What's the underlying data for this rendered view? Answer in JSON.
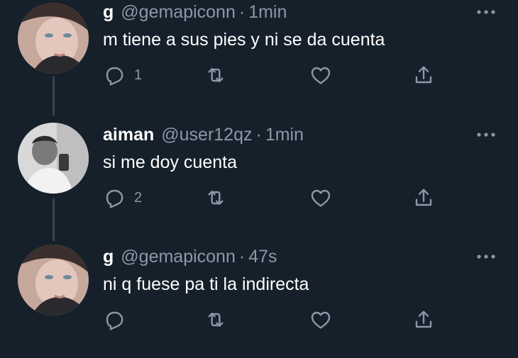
{
  "colors": {
    "background": "#15202b",
    "primary_text": "#ffffff",
    "secondary_text": "#8b98a5",
    "thread_line": "#38444d"
  },
  "tweets": [
    {
      "name": "g",
      "handle": "@gemapiconn",
      "separator": "·",
      "time": "1min",
      "text": "m tiene a sus pies y ni se da cuenta",
      "reply_count": "1",
      "icons": [
        "reply-icon",
        "retweet-icon",
        "like-icon",
        "share-icon",
        "more-icon"
      ]
    },
    {
      "name": "aiman",
      "handle": "@user12qz",
      "separator": "·",
      "time": "1min",
      "text": "si me doy cuenta",
      "reply_count": "2",
      "icons": [
        "reply-icon",
        "retweet-icon",
        "like-icon",
        "share-icon",
        "more-icon"
      ]
    },
    {
      "name": "g",
      "handle": "@gemapiconn",
      "separator": "·",
      "time": "47s",
      "text": "ni q fuese pa ti la indirecta",
      "reply_count": "",
      "icons": [
        "reply-icon",
        "retweet-icon",
        "like-icon",
        "share-icon",
        "more-icon"
      ]
    }
  ]
}
